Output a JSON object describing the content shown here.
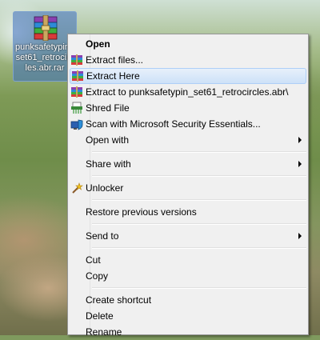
{
  "desktop": {
    "file_icon_label": "punksafetypin_set61_retrocircles.abr.rar",
    "file_icon": "winrar-archive-icon"
  },
  "context_menu": {
    "items": [
      {
        "label": "Open",
        "bold": true
      },
      {
        "label": "Extract files...",
        "icon": "winrar-icon"
      },
      {
        "label": "Extract Here",
        "icon": "winrar-icon",
        "selected": true
      },
      {
        "label": "Extract to punksafetypin_set61_retrocircles.abr\\",
        "icon": "winrar-icon"
      },
      {
        "label": "Shred File",
        "icon": "shred-icon"
      },
      {
        "label": "Scan with Microsoft Security Essentials...",
        "icon": "security-essentials-icon"
      },
      {
        "label": "Open with",
        "submenu": true
      },
      {
        "label": "Share with",
        "submenu": true
      },
      {
        "label": "Unlocker",
        "icon": "unlocker-wand-icon"
      },
      {
        "label": "Restore previous versions"
      },
      {
        "label": "Send to",
        "submenu": true
      },
      {
        "label": "Cut"
      },
      {
        "label": "Copy"
      },
      {
        "label": "Create shortcut"
      },
      {
        "label": "Delete"
      },
      {
        "label": "Rename"
      }
    ]
  },
  "colors": {
    "menu_bg": "#f0f0f0",
    "highlight_bg": "#cde1f8",
    "highlight_border": "#aecff7"
  }
}
